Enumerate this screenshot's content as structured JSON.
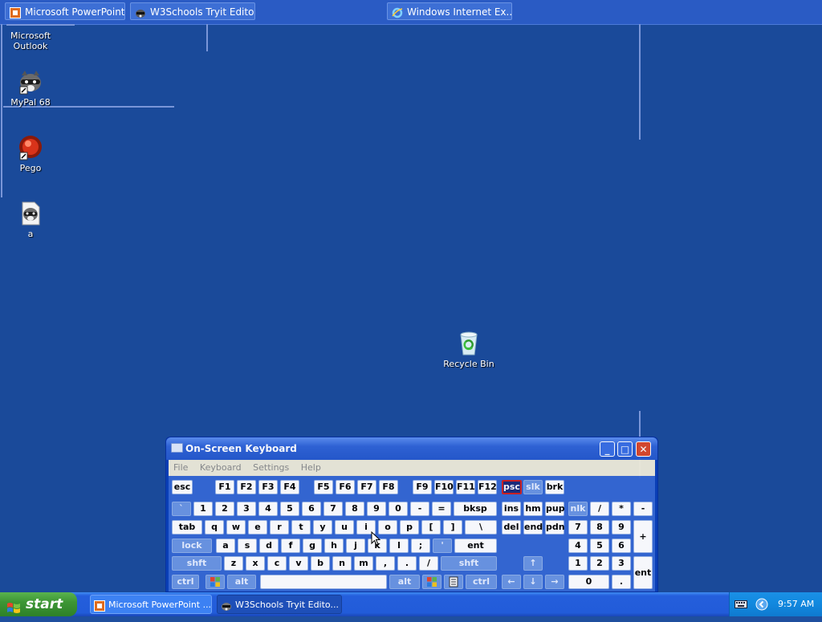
{
  "top_windows": [
    {
      "label": "Microsoft PowerPoint ...",
      "icon": "powerpoint-icon"
    },
    {
      "label": "W3Schools Tryit Edito...",
      "icon": "raccoon-icon"
    },
    {
      "label": "Windows Internet Ex...",
      "icon": "ie-icon"
    }
  ],
  "desktop_icons": [
    {
      "label": "Microsoft Outlook",
      "icon": "outlook-icon"
    },
    {
      "label": "MyPal 68",
      "icon": "raccoon-icon"
    },
    {
      "label": "Pego",
      "icon": "pego-icon"
    },
    {
      "label": "a",
      "icon": "file-raccoon-icon"
    },
    {
      "label": "Recycle Bin",
      "icon": "recycle-bin-icon"
    }
  ],
  "osk": {
    "title": "On-Screen Keyboard",
    "menu": [
      "File",
      "Keyboard",
      "Settings",
      "Help"
    ],
    "window_buttons": {
      "minimize": "_",
      "maximize": "□",
      "close": "✕"
    },
    "keys": {
      "esc": "esc",
      "f1": "F1",
      "f2": "F2",
      "f3": "F3",
      "f4": "F4",
      "f5": "F5",
      "f6": "F6",
      "f7": "F7",
      "f8": "F8",
      "f9": "F9",
      "f10": "F10",
      "f11": "F11",
      "f12": "F12",
      "psc": "psc",
      "slk": "slk",
      "brk": "brk",
      "backtick": "`",
      "n1": "1",
      "n2": "2",
      "n3": "3",
      "n4": "4",
      "n5": "5",
      "n6": "6",
      "n7": "7",
      "n8": "8",
      "n9": "9",
      "n0": "0",
      "minus": "-",
      "equals": "=",
      "bksp": "bksp",
      "ins": "ins",
      "hm": "hm",
      "pup": "pup",
      "nlk": "nlk",
      "np_div": "/",
      "np_mul": "*",
      "np_sub": "-",
      "tab": "tab",
      "q": "q",
      "w": "w",
      "e": "e",
      "r": "r",
      "t": "t",
      "y": "y",
      "u": "u",
      "i": "i",
      "o": "o",
      "p": "p",
      "lbr": "[",
      "rbr": "]",
      "bslash": "\\",
      "del": "del",
      "end": "end",
      "pdn": "pdn",
      "np7": "7",
      "np8": "8",
      "np9": "9",
      "np_add": "+",
      "lock": "lock",
      "a": "a",
      "s": "s",
      "d": "d",
      "f": "f",
      "g": "g",
      "h": "h",
      "j": "j",
      "k": "k",
      "l": "l",
      "semi": ";",
      "quote": "'",
      "ent": "ent",
      "np4": "4",
      "np5": "5",
      "np6": "6",
      "shft": "shft",
      "z": "z",
      "x": "x",
      "c": "c",
      "v": "v",
      "b": "b",
      "n": "n",
      "m": "m",
      "comma": ",",
      "period": ".",
      "slash": "/",
      "up": "↑",
      "np1": "1",
      "np2": "2",
      "np3": "3",
      "np_ent": "ent",
      "ctrl": "ctrl",
      "alt": "alt",
      "left": "←",
      "down": "↓",
      "right": "→",
      "np0": "0",
      "np_dot": "."
    }
  },
  "taskbar": {
    "start_label": "start",
    "buttons": [
      {
        "label": "Microsoft PowerPoint ...",
        "icon": "powerpoint-icon"
      },
      {
        "label": "W3Schools Tryit Edito...",
        "icon": "raccoon-icon"
      }
    ],
    "clock": "9:57 AM"
  }
}
